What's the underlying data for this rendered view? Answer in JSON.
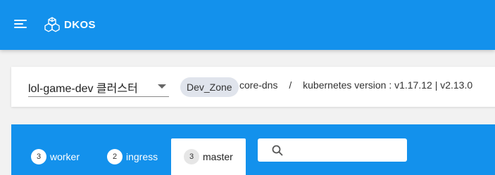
{
  "header": {
    "menu_icon": "hamburger-menu-icon",
    "logo_icon": "cube-cluster-logo-icon",
    "logo_text": "DKOS",
    "background_color": "#1391ec"
  },
  "cluster_bar": {
    "cluster_select": {
      "value": "lol-game-dev 클러스터"
    },
    "zone_chip": "Dev_Zone",
    "service": "core-dns",
    "separator": "/",
    "kubernetes_version": "kubernetes version : v1.17.12 | v2.13.0"
  },
  "node_tabs": {
    "items": [
      {
        "count": "3",
        "label": "worker",
        "active": false
      },
      {
        "count": "2",
        "label": "ingress",
        "active": false
      },
      {
        "count": "3",
        "label": "master",
        "active": true
      }
    ],
    "search": {
      "icon": "search-icon",
      "value": "",
      "placeholder": ""
    }
  }
}
